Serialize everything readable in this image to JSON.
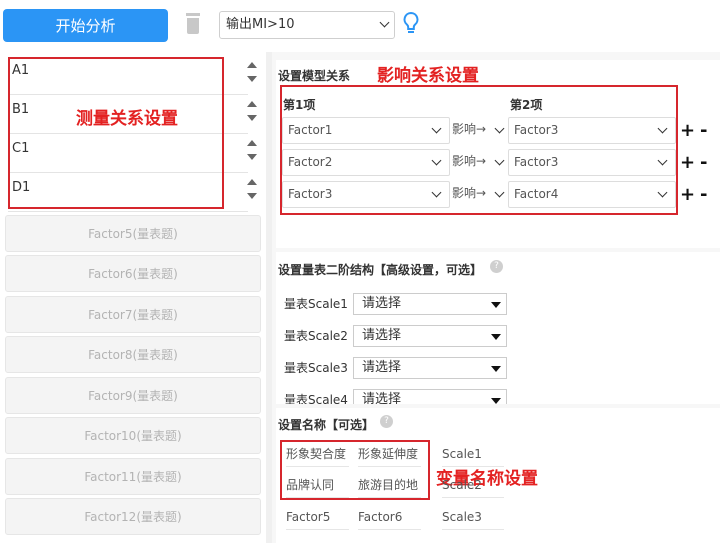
{
  "toolbar": {
    "start_label": "开始分析",
    "output_value": "输出MI>10"
  },
  "measurement": {
    "rows": [
      "A1",
      "B1",
      "C1",
      "D1"
    ],
    "annotation": "测量关系设置"
  },
  "factors": [
    "Factor5(量表题)",
    "Factor6(量表题)",
    "Factor7(量表题)",
    "Factor8(量表题)",
    "Factor9(量表题)",
    "Factor10(量表题)",
    "Factor11(量表题)",
    "Factor12(量表题)"
  ],
  "model": {
    "title": "设置模型关系",
    "annotation": "影响关系设置",
    "col1": "第1项",
    "col2": "第2项",
    "plus": "+",
    "minus": "-",
    "rows": [
      {
        "from": "Factor1",
        "rel": "影响→",
        "to": "Factor3"
      },
      {
        "from": "Factor2",
        "rel": "影响→",
        "to": "Factor3"
      },
      {
        "from": "Factor3",
        "rel": "影响→",
        "to": "Factor4"
      }
    ]
  },
  "second_order": {
    "title": "设置量表二阶结构【高级设置，可选】",
    "rows": [
      {
        "label": "量表Scale1",
        "value": "请选择"
      },
      {
        "label": "量表Scale2",
        "value": "请选择"
      },
      {
        "label": "量表Scale3",
        "value": "请选择"
      },
      {
        "label": "量表Scale4",
        "value": "请选择"
      }
    ]
  },
  "naming": {
    "title": "设置名称【可选】",
    "annotation": "变量名称设置",
    "row1": [
      "形象契合度",
      "形象延伸度",
      "Scale1"
    ],
    "row2": [
      "品牌认同",
      "旅游目的地",
      "Scale2"
    ],
    "row3": [
      "Factor5",
      "Factor6",
      "Scale3"
    ]
  },
  "colors": {
    "accent": "#2b95f5",
    "annotation_red": "#e32222"
  },
  "icons": [
    "trash-icon",
    "chevron-down-icon",
    "lightbulb-icon",
    "help-icon",
    "spinner-up-icon",
    "spinner-down-icon"
  ]
}
